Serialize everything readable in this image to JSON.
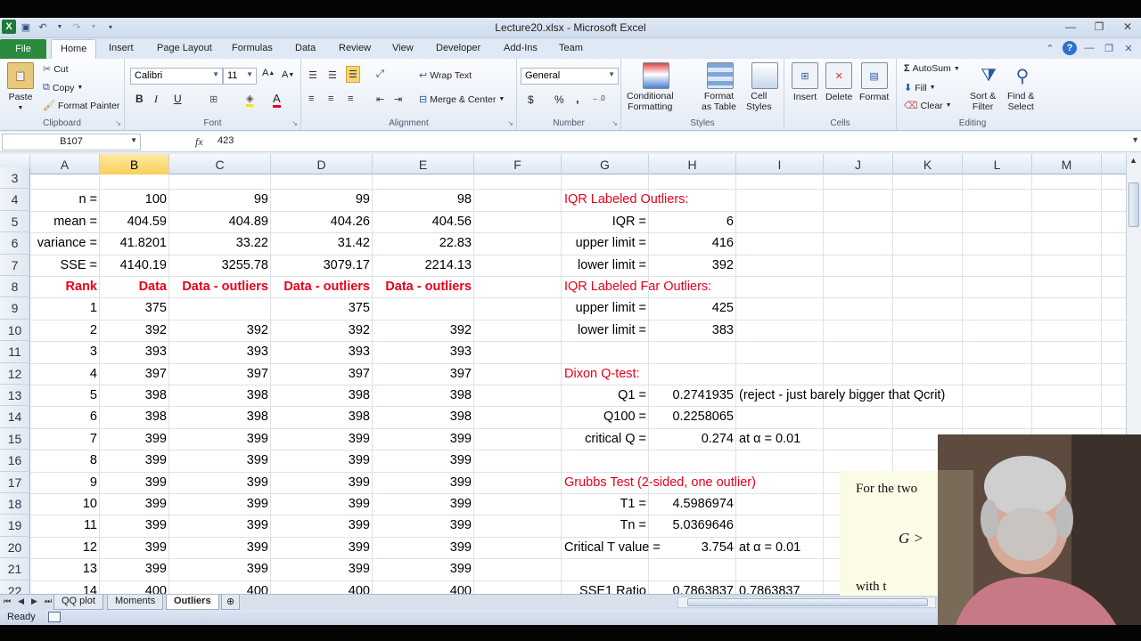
{
  "window": {
    "title": "Lecture20.xlsx - Microsoft Excel"
  },
  "tabs": [
    "File",
    "Home",
    "Insert",
    "Page Layout",
    "Formulas",
    "Data",
    "Review",
    "View",
    "Developer",
    "Add-Ins",
    "Team"
  ],
  "ribbon": {
    "clipboard": {
      "paste": "Paste",
      "cut": "Cut",
      "copy": "Copy",
      "format_painter": "Format Painter",
      "label": "Clipboard"
    },
    "font": {
      "family": "Calibri",
      "size": "11",
      "label": "Font",
      "bold": "B",
      "italic": "I",
      "underline": "U"
    },
    "alignment": {
      "wrap": "Wrap Text",
      "merge": "Merge & Center",
      "label": "Alignment"
    },
    "number": {
      "format": "General",
      "label": "Number",
      "currency": "$",
      "percent": "%",
      "comma": ","
    },
    "styles": {
      "conditional": "Conditional\nFormatting",
      "format_table": "Format\nas Table",
      "cell_styles": "Cell\nStyles",
      "label": "Styles"
    },
    "cells": {
      "insert": "Insert",
      "delete": "Delete",
      "format": "Format",
      "label": "Cells"
    },
    "editing": {
      "autosum": "AutoSum",
      "fill": "Fill",
      "clear": "Clear",
      "sort": "Sort &\nFilter",
      "find": "Find &\nSelect",
      "label": "Editing"
    }
  },
  "formula_bar": {
    "name_box": "B107",
    "fx": "fx",
    "value": "423"
  },
  "columns": [
    "A",
    "B",
    "C",
    "D",
    "E",
    "F",
    "G",
    "H",
    "I",
    "J",
    "K",
    "L",
    "M"
  ],
  "selected_column": "B",
  "rows": [
    "3",
    "4",
    "5",
    "6",
    "7",
    "8",
    "9",
    "10",
    "11",
    "12",
    "13",
    "14",
    "15",
    "16",
    "17",
    "18",
    "19",
    "20",
    "21",
    "22"
  ],
  "cells": {
    "A4": "n =",
    "B4": "100",
    "C4": "99",
    "D4": "99",
    "E4": "98",
    "A5": "mean =",
    "B5": "404.59",
    "C5": "404.89",
    "D5": "404.26",
    "E5": "404.56",
    "A6": "variance =",
    "B6": "41.8201",
    "C6": "33.22",
    "D6": "31.42",
    "E6": "22.83",
    "A7": "SSE =",
    "B7": "4140.19",
    "C7": "3255.78",
    "D7": "3079.17",
    "E7": "2214.13",
    "A8": "Rank",
    "B8": "Data",
    "C8": "Data - outliers",
    "D8": "Data - outliers",
    "E8": "Data - outliers",
    "A9": "1",
    "B9": "375",
    "D9": "375",
    "A10": "2",
    "B10": "392",
    "C10": "392",
    "D10": "392",
    "E10": "392",
    "A11": "3",
    "B11": "393",
    "C11": "393",
    "D11": "393",
    "E11": "393",
    "A12": "4",
    "B12": "397",
    "C12": "397",
    "D12": "397",
    "E12": "397",
    "A13": "5",
    "B13": "398",
    "C13": "398",
    "D13": "398",
    "E13": "398",
    "A14": "6",
    "B14": "398",
    "C14": "398",
    "D14": "398",
    "E14": "398",
    "A15": "7",
    "B15": "399",
    "C15": "399",
    "D15": "399",
    "E15": "399",
    "A16": "8",
    "B16": "399",
    "C16": "399",
    "D16": "399",
    "E16": "399",
    "A17": "9",
    "B17": "399",
    "C17": "399",
    "D17": "399",
    "E17": "399",
    "A18": "10",
    "B18": "399",
    "C18": "399",
    "D18": "399",
    "E18": "399",
    "A19": "11",
    "B19": "399",
    "C19": "399",
    "D19": "399",
    "E19": "399",
    "A20": "12",
    "B20": "399",
    "C20": "399",
    "D20": "399",
    "E20": "399",
    "A21": "13",
    "B21": "399",
    "C21": "399",
    "D21": "399",
    "E21": "399",
    "A22": "14",
    "B22": "400",
    "C22": "400",
    "D22": "400",
    "E22": "400",
    "G4": "IQR Labeled Outliers:",
    "G5": "IQR =",
    "H5": "6",
    "G6": "upper limit  =",
    "H6": "416",
    "G7": "lower limit =",
    "H7": "392",
    "G8": "IQR Labeled Far Outliers:",
    "G9": "upper limit  =",
    "H9": "425",
    "G10": "lower limit =",
    "H10": "383",
    "G12": "Dixon Q-test:",
    "G13": "Q1 =",
    "H13": "0.2741935",
    "I13": "(reject - just barely bigger that Qcrit)",
    "G14": "Q100 =",
    "H14": "0.2258065",
    "G15": "critical Q =",
    "H15": "0.274",
    "I15": "at α = 0.01",
    "G17": "Grubbs Test (2-sided, one outlier)",
    "G18": "T1 =",
    "H18": "4.5986974",
    "G19": "Tn =",
    "H19": "5.0369646",
    "G20": "Critical T value =",
    "H20": "3.754",
    "I20": "at α = 0.01",
    "G22": "SSE1 Ratio",
    "H22": "0.7863837",
    "I22": "0.7863837"
  },
  "sheets": [
    "QQ plot",
    "Moments",
    "Outliers"
  ],
  "active_sheet": "Outliers",
  "status": {
    "ready": "Ready"
  },
  "overlay_doc": {
    "line1": "For the two",
    "line2": "G >",
    "line3": "with t"
  }
}
